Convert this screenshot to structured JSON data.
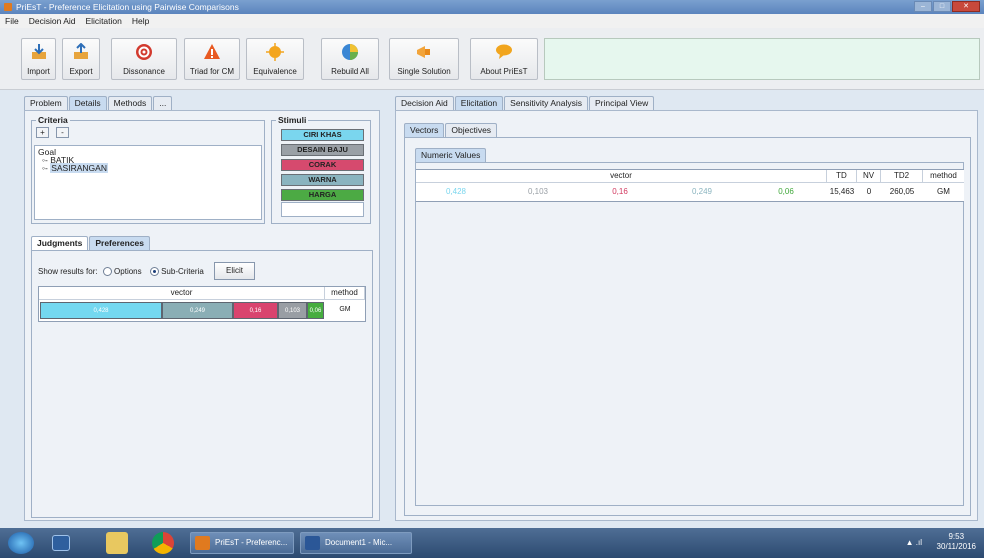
{
  "window": {
    "title": "PriEsT - Preference Elicitation using Pairwise Comparisons"
  },
  "menu": [
    "File",
    "Decision Aid",
    "Elicitation",
    "Help"
  ],
  "toolbar": [
    {
      "label": "Import",
      "icon": "import-icon"
    },
    {
      "label": "Export",
      "icon": "export-icon"
    },
    {
      "label": "Dissonance",
      "icon": "target-icon"
    },
    {
      "label": "Triad for CM",
      "icon": "warning-triangle-icon"
    },
    {
      "label": "Equivalence",
      "icon": "sun-icon"
    },
    {
      "label": "Rebuild All",
      "icon": "pie-chart-icon"
    },
    {
      "label": "Single Solution",
      "icon": "megaphone-icon"
    },
    {
      "label": "About PriEsT",
      "icon": "speech-bubble-icon"
    }
  ],
  "left": {
    "tabs": [
      "Problem",
      "Details",
      "Methods",
      "..."
    ],
    "criteria": {
      "title": "Criteria",
      "add": "+",
      "remove": "-",
      "tree": {
        "root": "Goal",
        "children": [
          "BATIK",
          "SASIRANGAN"
        ]
      }
    },
    "stimuli": {
      "title": "Stimuli",
      "items": [
        {
          "label": "CIRI KHAS",
          "color": "#7ad6ee"
        },
        {
          "label": "DESAIN BAJU",
          "color": "#9aa0a6"
        },
        {
          "label": "CORAK",
          "color": "#d64a6e"
        },
        {
          "label": "WARNA",
          "color": "#8ab4bf"
        },
        {
          "label": "HARGA",
          "color": "#4caa44"
        }
      ]
    },
    "lower_tabs": [
      "Judgments",
      "Preferences"
    ],
    "show_results_label": "Show results for:",
    "options_label": "Options",
    "subcriteria_label": "Sub-Criteria",
    "elicit_button": "Elicit",
    "pref_table": {
      "headers": [
        "vector",
        "method"
      ],
      "segments": [
        {
          "label": "0,428",
          "value": 0.428,
          "color": "#74d8f0"
        },
        {
          "label": "0,249",
          "value": 0.249,
          "color": "#8aaeb5"
        },
        {
          "label": "0,16",
          "value": 0.16,
          "color": "#d9446e"
        },
        {
          "label": "0,103",
          "value": 0.103,
          "color": "#999ea4"
        },
        {
          "label": "0,06",
          "value": 0.06,
          "color": "#46ad3f"
        }
      ],
      "method": "GM"
    }
  },
  "right": {
    "tabs": [
      "Decision Aid",
      "Elicitation",
      "Sensitivity Analysis",
      "Principal View"
    ],
    "subtabs": [
      "Vectors",
      "Objectives"
    ],
    "inner_tab": "Numeric Values",
    "table": {
      "headers": [
        "vector",
        "TD",
        "NV",
        "TD2",
        "method"
      ],
      "values": [
        {
          "text": "0,428",
          "color": "#7ad6ee"
        },
        {
          "text": "0,103",
          "color": "#9aa0a6"
        },
        {
          "text": "0,16",
          "color": "#d2385f"
        },
        {
          "text": "0,249",
          "color": "#8ab4bf"
        },
        {
          "text": "0,06",
          "color": "#3fa83a"
        }
      ],
      "td": "15,463",
      "nv": "0",
      "td2": "260,05",
      "method": "GM"
    }
  },
  "taskbar": {
    "items": [
      "PriEsT - Preferenc...",
      "Document1 - Mic..."
    ],
    "time": "9:53",
    "date": "30/11/2016"
  }
}
